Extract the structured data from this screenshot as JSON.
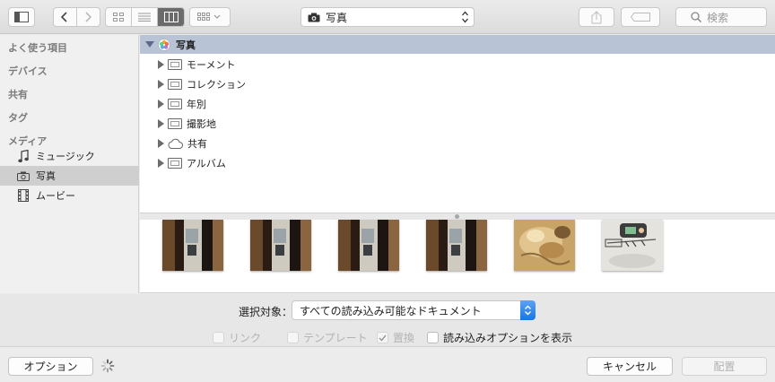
{
  "toolbar": {
    "location": "写真",
    "search_placeholder": "検索"
  },
  "sidebar": {
    "sections": [
      "よく使う項目",
      "デバイス",
      "共有",
      "タグ",
      "メディア"
    ],
    "media_items": [
      {
        "label": "ミュージック",
        "icon": "music-note-icon"
      },
      {
        "label": "写真",
        "icon": "camera-icon",
        "selected": true
      },
      {
        "label": "ムービー",
        "icon": "film-icon"
      }
    ]
  },
  "browser": {
    "root": "写真",
    "items": [
      "モーメント",
      "コレクション",
      "年別",
      "撮影地",
      "共有",
      "アルバム"
    ]
  },
  "thumbnails": [
    "door-photo",
    "door-photo",
    "door-photo",
    "door-photo",
    "food-photo",
    "sticker-photo"
  ],
  "options": {
    "select_label": "選択対象：",
    "select_value": "すべての読み込み可能なドキュメント",
    "checkboxes": [
      {
        "label": "リンク",
        "checked": false,
        "enabled": false
      },
      {
        "label": "テンプレート",
        "checked": false,
        "enabled": false
      },
      {
        "label": "置換",
        "checked": true,
        "enabled": false
      },
      {
        "label": "読み込みオプションを表示",
        "checked": false,
        "enabled": true
      }
    ]
  },
  "buttons": {
    "options": "オプション",
    "cancel": "キャンセル",
    "place": "配置"
  },
  "colors": {
    "accent": "#1b74e6",
    "root_highlight": "#b9c3d6",
    "sidebar_selection": "#cfcfcf"
  }
}
